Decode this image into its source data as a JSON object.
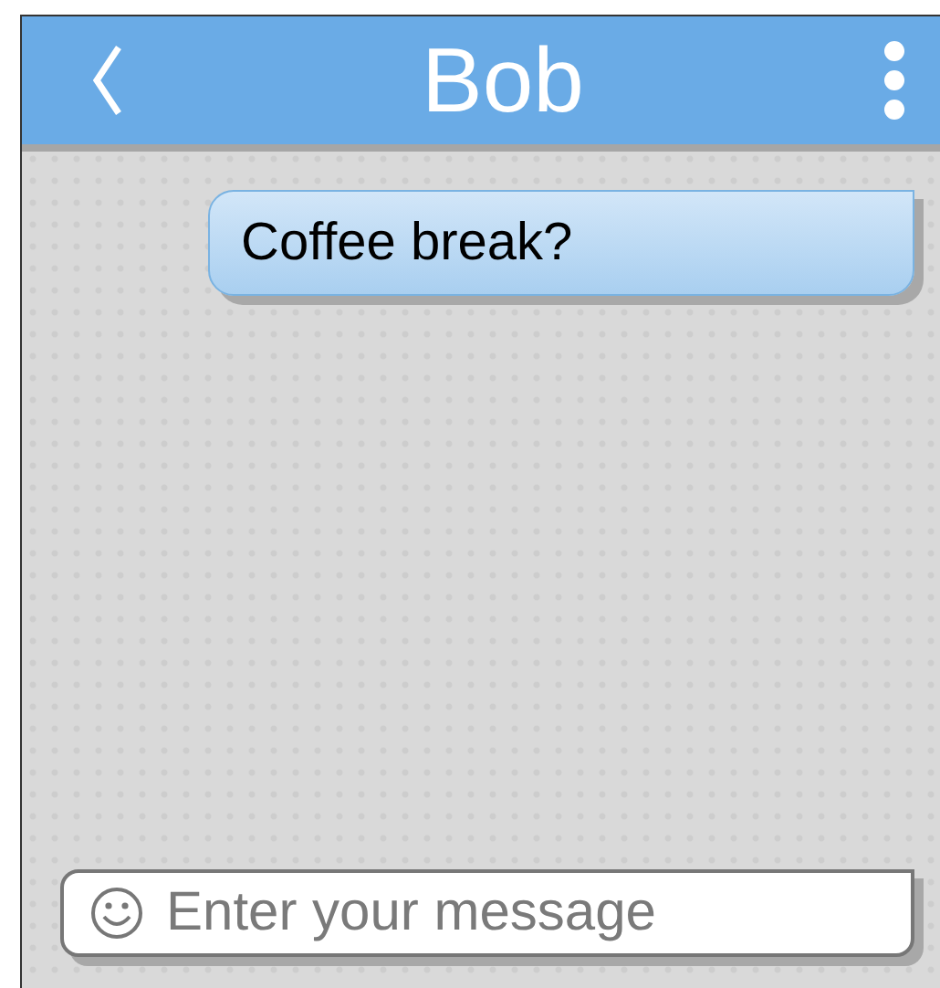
{
  "header": {
    "title": "Bob"
  },
  "messages": [
    {
      "text": "Coffee break?",
      "outgoing": true
    }
  ],
  "composer": {
    "placeholder": "Enter your message"
  }
}
